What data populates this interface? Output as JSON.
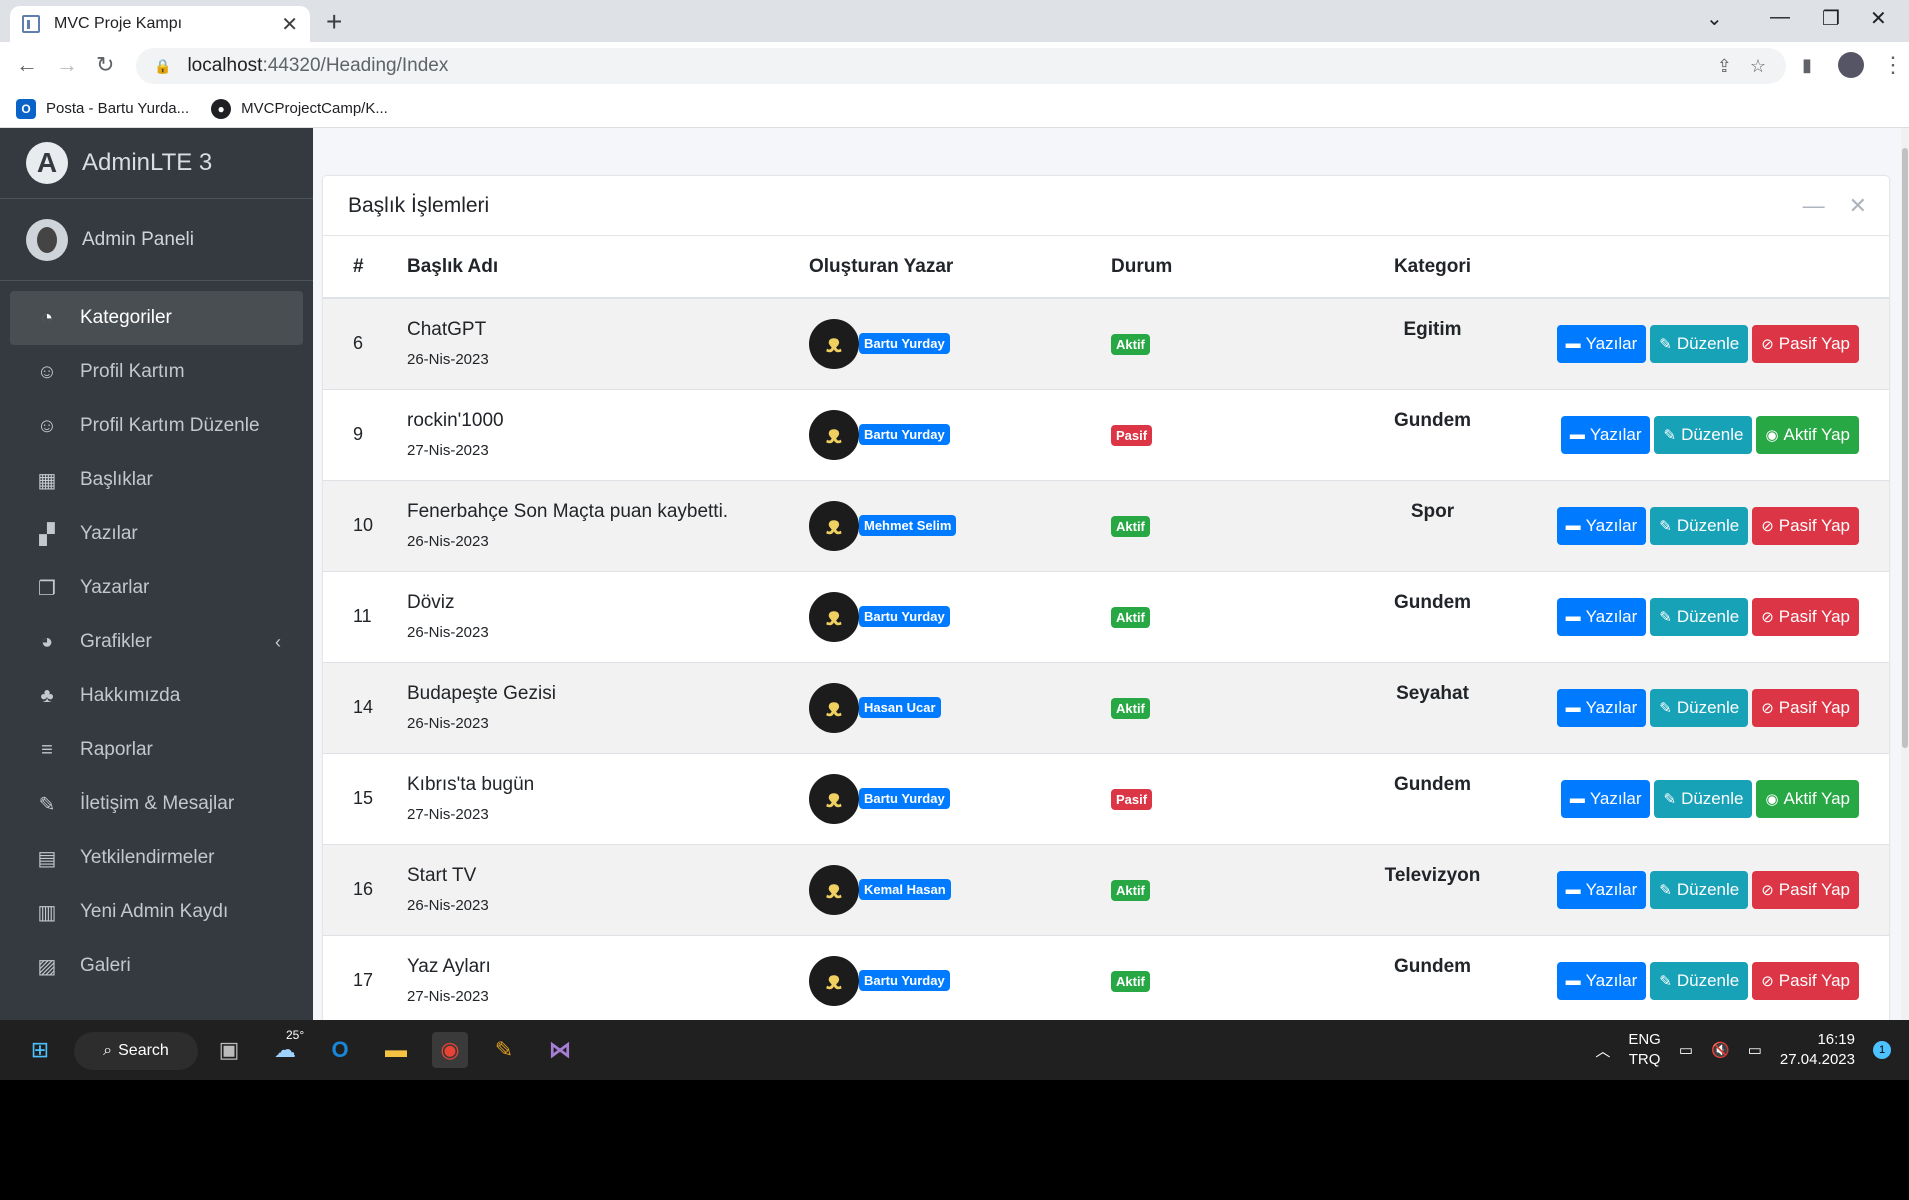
{
  "browser": {
    "tab_title": "MVC Proje Kampı",
    "url_host": "localhost",
    "url_rest": ":44320/Heading/Index",
    "bookmarks": [
      {
        "label": "Posta - Bartu Yurda...",
        "icon": "outlook-icon"
      },
      {
        "label": "MVCProjectCamp/K...",
        "icon": "github-icon"
      }
    ]
  },
  "sidebar": {
    "brand": "AdminLTE 3",
    "user": "Admin Paneli",
    "items": [
      {
        "label": "Kategoriler",
        "icon": "dashboard-icon",
        "active": true
      },
      {
        "label": "Profil Kartım",
        "icon": "user-icon"
      },
      {
        "label": "Profil Kartım Düzenle",
        "icon": "user-edit-icon"
      },
      {
        "label": "Başlıklar",
        "icon": "grid-icon"
      },
      {
        "label": "Yazılar",
        "icon": "person-booth-icon"
      },
      {
        "label": "Yazarlar",
        "icon": "copy-icon"
      },
      {
        "label": "Grafikler",
        "icon": "pie-chart-icon",
        "arrow": "‹"
      },
      {
        "label": "Hakkımızda",
        "icon": "tree-icon"
      },
      {
        "label": "Raporlar",
        "icon": "list-icon"
      },
      {
        "label": "İletişim & Mesajlar",
        "icon": "edit-icon"
      },
      {
        "label": "Yetkilendirmeler",
        "icon": "calendar-icon"
      },
      {
        "label": "Yeni Admin Kaydı",
        "icon": "book-icon"
      },
      {
        "label": "Galeri",
        "icon": "image-icon"
      }
    ]
  },
  "card": {
    "title": "Başlık İşlemleri",
    "headers": [
      "#",
      "Başlık Adı",
      "Oluşturan Yazar",
      "Durum",
      "Kategori",
      ""
    ],
    "rows": [
      {
        "id": "6",
        "title": "ChatGPT",
        "date": "26-Nis-2023",
        "author": "Bartu Yurday",
        "status": "Aktif",
        "category": "Egitim",
        "toggle": "Pasif Yap"
      },
      {
        "id": "9",
        "title": "rockin'1000",
        "date": "27-Nis-2023",
        "author": "Bartu Yurday",
        "status": "Pasif",
        "category": "Gundem",
        "toggle": "Aktif Yap"
      },
      {
        "id": "10",
        "title": "Fenerbahçe Son Maçta puan kaybetti.",
        "date": "26-Nis-2023",
        "author": "Mehmet Selim",
        "status": "Aktif",
        "category": "Spor",
        "toggle": "Pasif Yap"
      },
      {
        "id": "11",
        "title": "Döviz",
        "date": "26-Nis-2023",
        "author": "Bartu Yurday",
        "status": "Aktif",
        "category": "Gundem",
        "toggle": "Pasif Yap"
      },
      {
        "id": "14",
        "title": "Budapeşte Gezisi",
        "date": "26-Nis-2023",
        "author": "Hasan Ucar",
        "status": "Aktif",
        "category": "Seyahat",
        "toggle": "Pasif Yap"
      },
      {
        "id": "15",
        "title": "Kıbrıs'ta bugün",
        "date": "27-Nis-2023",
        "author": "Bartu Yurday",
        "status": "Pasif",
        "category": "Gundem",
        "toggle": "Aktif Yap"
      },
      {
        "id": "16",
        "title": "Start TV",
        "date": "26-Nis-2023",
        "author": "Kemal Hasan",
        "status": "Aktif",
        "category": "Televizyon",
        "toggle": "Pasif Yap"
      },
      {
        "id": "17",
        "title": "Yaz Ayları",
        "date": "27-Nis-2023",
        "author": "Bartu Yurday",
        "status": "Aktif",
        "category": "Gundem",
        "toggle": "Pasif Yap"
      }
    ],
    "btn_posts": "Yazılar",
    "btn_edit": "Düzenle"
  },
  "taskbar": {
    "search": "Search",
    "weather": "25°",
    "lang1": "ENG",
    "lang2": "TRQ",
    "time": "16:19",
    "date": "27.04.2023",
    "notifications": "1"
  }
}
